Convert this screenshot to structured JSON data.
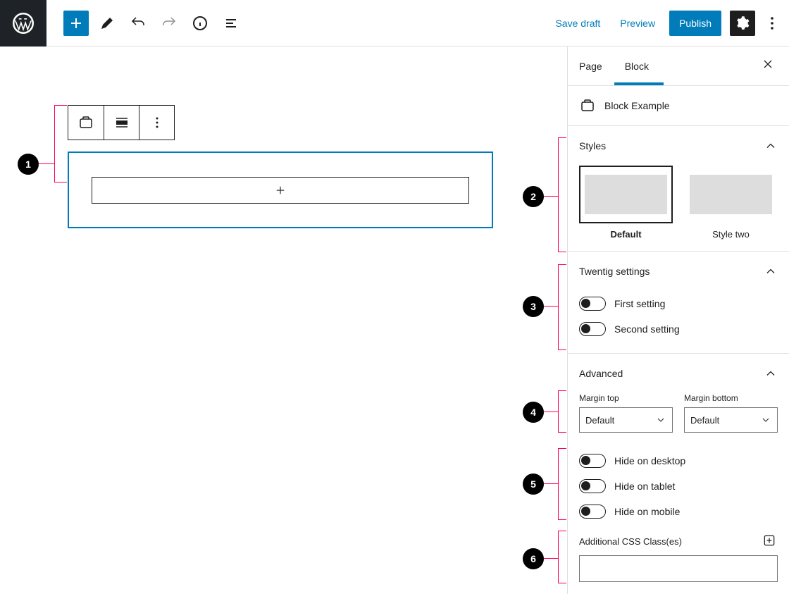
{
  "topbar": {
    "save_draft": "Save draft",
    "preview": "Preview",
    "publish": "Publish"
  },
  "sidebar": {
    "tabs": {
      "page": "Page",
      "block": "Block"
    },
    "block_name": "Block Example",
    "panels": {
      "styles": {
        "title": "Styles",
        "items": [
          {
            "label": "Default",
            "selected": true
          },
          {
            "label": "Style two",
            "selected": false
          }
        ]
      },
      "twentig": {
        "title": "Twentig settings",
        "toggles": [
          {
            "label": "First setting"
          },
          {
            "label": "Second setting"
          }
        ]
      },
      "advanced": {
        "title": "Advanced",
        "margin_top_label": "Margin top",
        "margin_bottom_label": "Margin bottom",
        "margin_top_value": "Default",
        "margin_bottom_value": "Default",
        "hide_toggles": [
          {
            "label": "Hide on desktop"
          },
          {
            "label": "Hide on tablet"
          },
          {
            "label": "Hide on mobile"
          }
        ],
        "css_label": "Additional CSS Class(es)",
        "css_value": ""
      }
    }
  },
  "callouts": [
    "1",
    "2",
    "3",
    "4",
    "5",
    "6"
  ]
}
